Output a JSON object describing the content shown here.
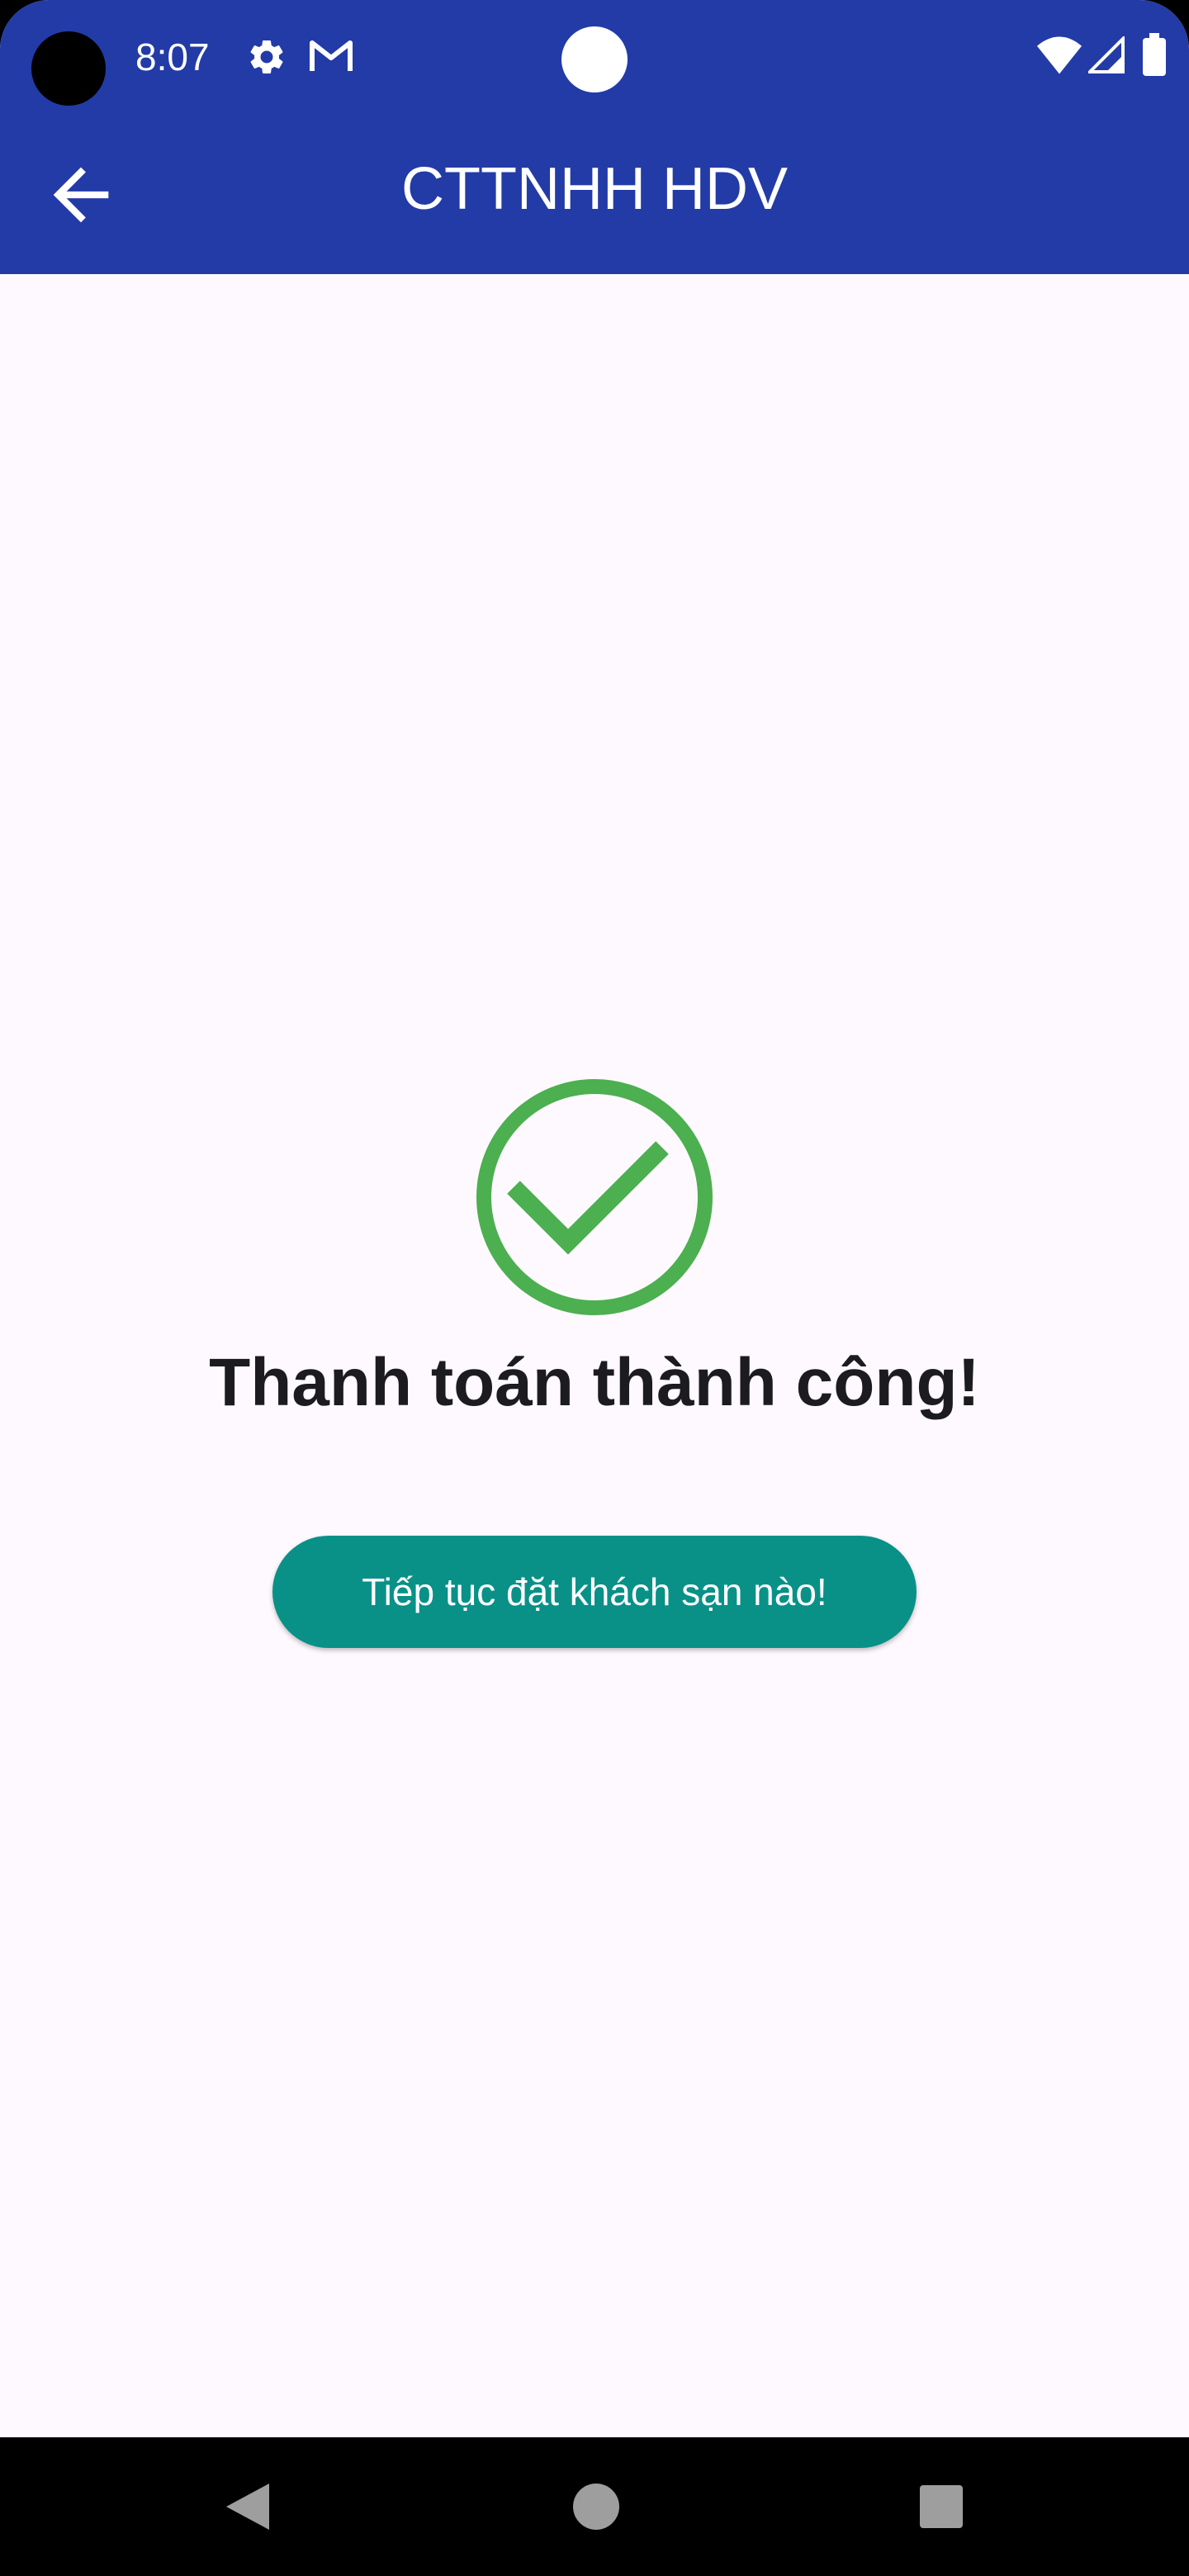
{
  "status_bar": {
    "time": "8:07",
    "icons": [
      "settings-icon",
      "gmail-icon",
      "wifi-icon",
      "signal-icon",
      "battery-icon"
    ]
  },
  "app_bar": {
    "title": "CTTNHH HDV",
    "back_icon": "arrow-back-icon"
  },
  "main": {
    "success_icon": "check-circle-icon",
    "title": "Thanh toán thành công!",
    "button_label": "Tiếp tục đặt khách sạn nào!"
  },
  "nav_bar": {
    "buttons": [
      "back-triangle-icon",
      "home-circle-icon",
      "recents-square-icon"
    ]
  },
  "colors": {
    "primary": "#233ba7",
    "accent_button": "#099188",
    "success_green": "#4caf50",
    "background": "#fdf9fe",
    "title_text": "#1c1b1f"
  }
}
